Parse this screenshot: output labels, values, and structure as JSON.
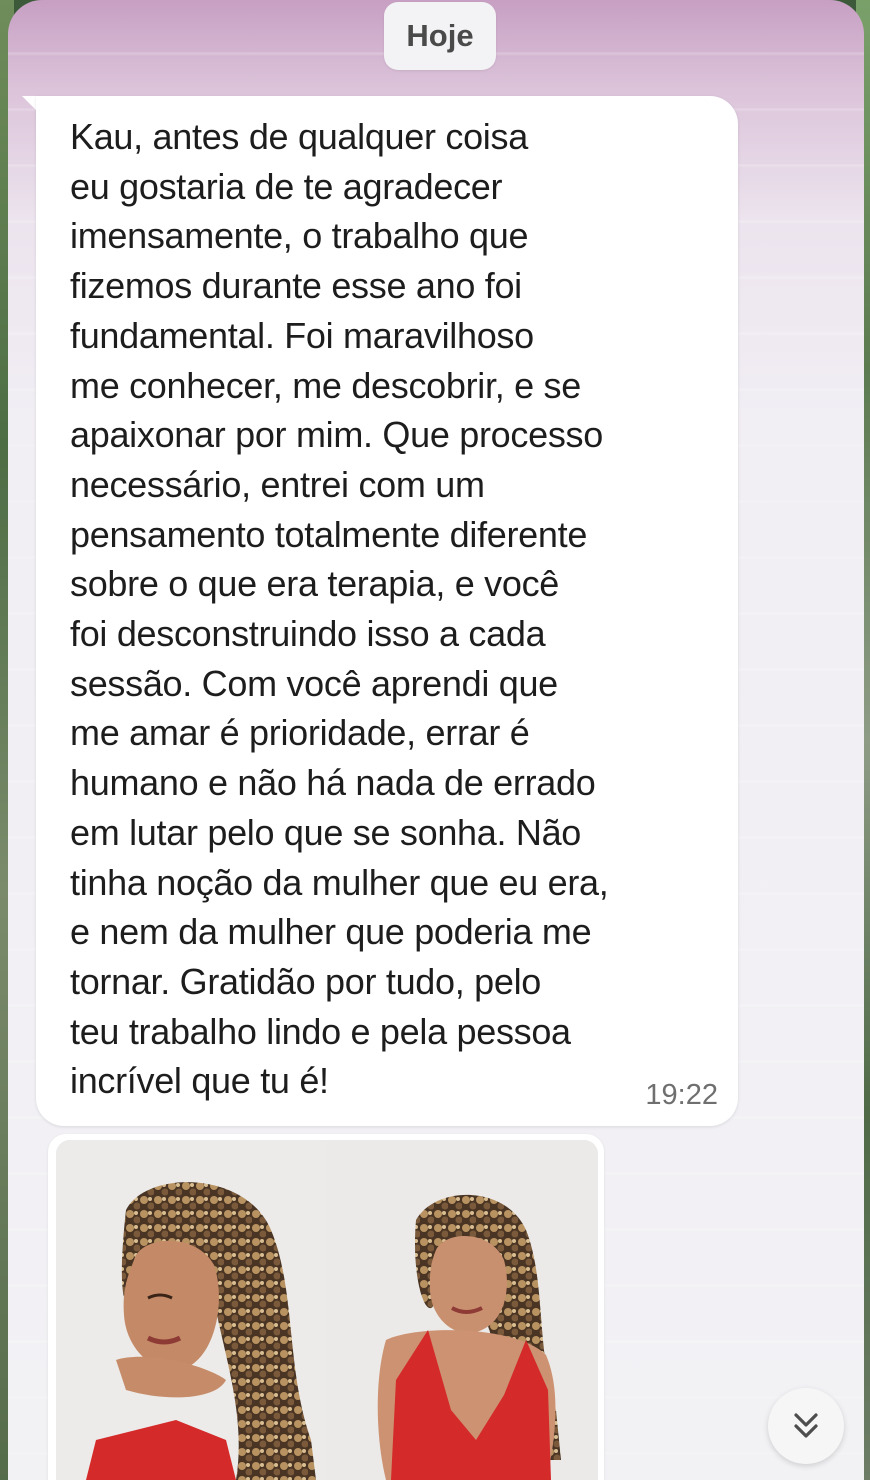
{
  "chat": {
    "date_label": "Hoje",
    "message": {
      "text": "Kau, antes de qualquer coisa\neu gostaria de te agradecer\nimensamente, o trabalho que\nfizemos durante esse ano foi\nfundamental. Foi maravilhoso\nme conhecer, me descobrir, e se\napaixonar por mim. Que processo\nnecessário, entrei com um\npensamento totalmente diferente\nsobre o que era terapia, e você\nfoi desconstruindo isso a cada\nsessão. Com você aprendi que\nme amar é prioridade, errar é\nhumano e não há nada de errado\nem lutar pelo que se sonha. Não\ntinha noção da mulher que eu era,\ne nem da mulher que poderia me\ntornar. Gratidão por tudo, pelo\nteu trabalho lindo e pela pessoa\nincrível que tu é!",
      "time": "19:22"
    },
    "image_message": {
      "icon": "photo-collage"
    },
    "scroll_button": {
      "icon": "double-chevron-down-icon"
    }
  },
  "colors": {
    "bubble": "#ffffff",
    "wallpaper_top": "#c79fc3",
    "dress_red": "#d42a2a"
  }
}
